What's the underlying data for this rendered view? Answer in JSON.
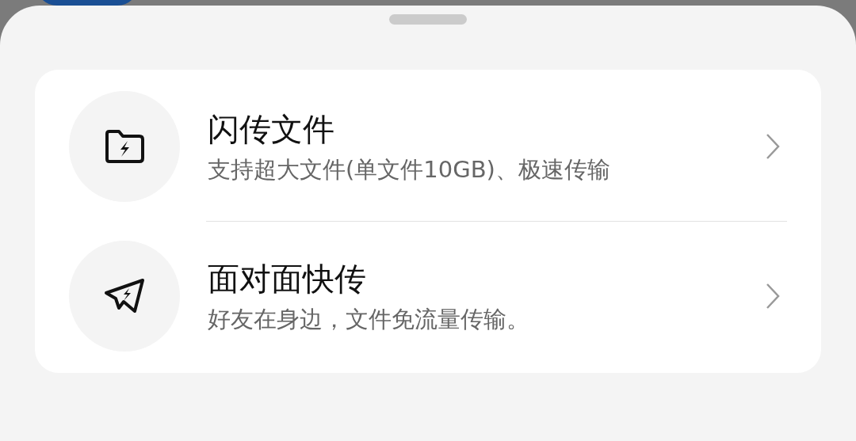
{
  "items": [
    {
      "kind": "folder",
      "title": "闪传文件",
      "subtitle": "支持超大文件(单文件10GB)、极速传输"
    },
    {
      "kind": "plane",
      "title": "面对面快传",
      "subtitle": "好友在身边，文件免流量传输。"
    }
  ]
}
